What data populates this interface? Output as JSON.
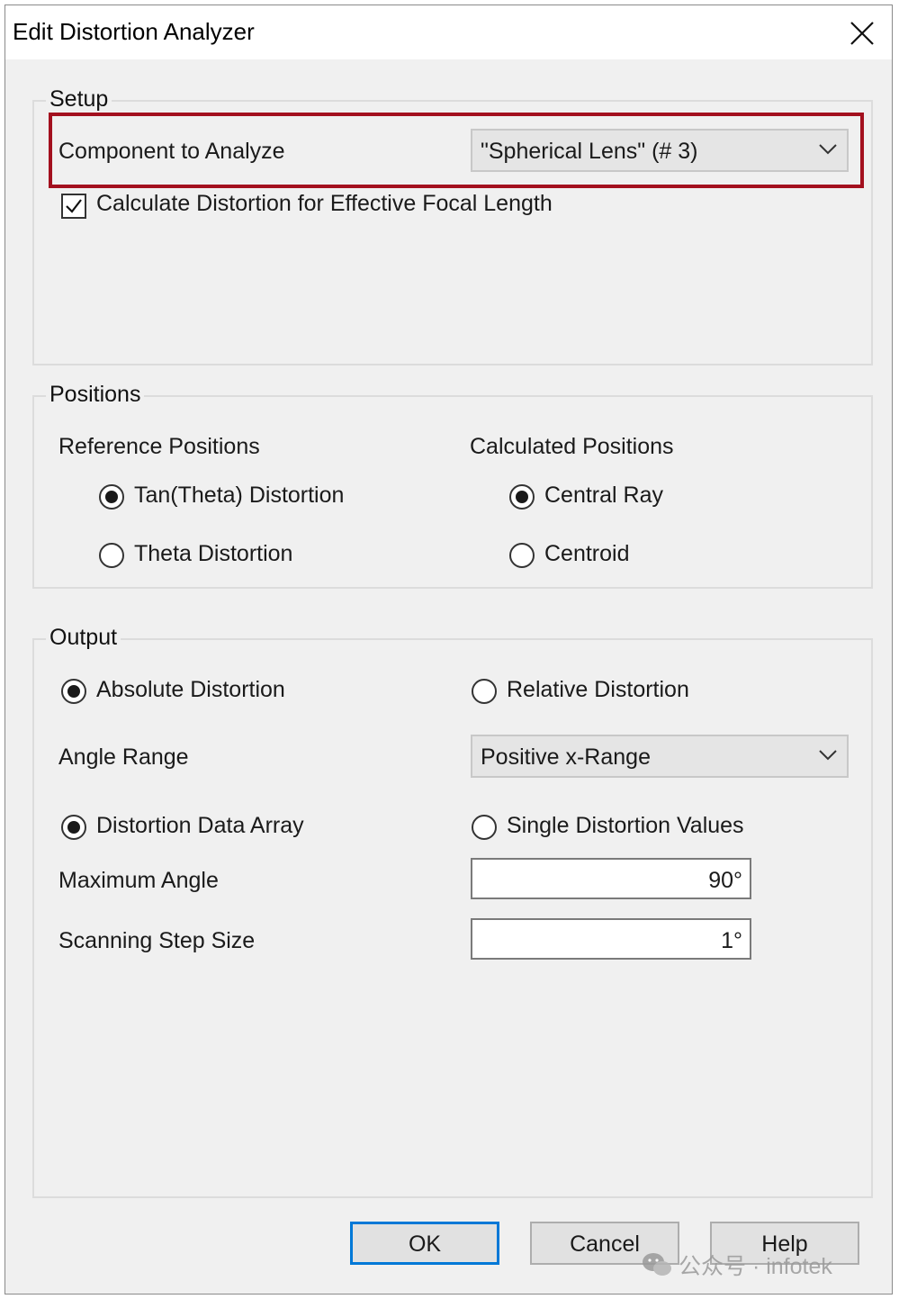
{
  "window": {
    "title": "Edit Distortion Analyzer",
    "close_icon": "close-icon"
  },
  "setup": {
    "legend": "Setup",
    "component_label": "Component to Analyze",
    "component_value": "\"Spherical Lens\" (# 3)",
    "effective_focal_label": "Calculate Distortion for Effective Focal Length",
    "effective_focal_checked": true
  },
  "positions": {
    "legend": "Positions",
    "reference_header": "Reference Positions",
    "reference_options": [
      {
        "label": "Tan(Theta) Distortion",
        "selected": true
      },
      {
        "label": "Theta Distortion",
        "selected": false
      }
    ],
    "calculated_header": "Calculated Positions",
    "calculated_options": [
      {
        "label": "Central Ray",
        "selected": true
      },
      {
        "label": "Centroid",
        "selected": false
      }
    ]
  },
  "output": {
    "legend": "Output",
    "distortion_type": [
      {
        "label": "Absolute Distortion",
        "selected": true
      },
      {
        "label": "Relative Distortion",
        "selected": false
      }
    ],
    "angle_range_label": "Angle Range",
    "angle_range_value": "Positive x-Range",
    "data_mode": [
      {
        "label": "Distortion Data Array",
        "selected": true
      },
      {
        "label": "Single Distortion Values",
        "selected": false
      }
    ],
    "max_angle_label": "Maximum Angle",
    "max_angle_value": "90°",
    "step_size_label": "Scanning Step Size",
    "step_size_value": "1°"
  },
  "buttons": {
    "ok": "OK",
    "cancel": "Cancel",
    "help": "Help"
  },
  "watermark": {
    "text": "公众号 · infotek",
    "icon": "wechat-icon"
  },
  "colors": {
    "highlight": "#a3101e",
    "default_button_border": "#0078d7"
  }
}
